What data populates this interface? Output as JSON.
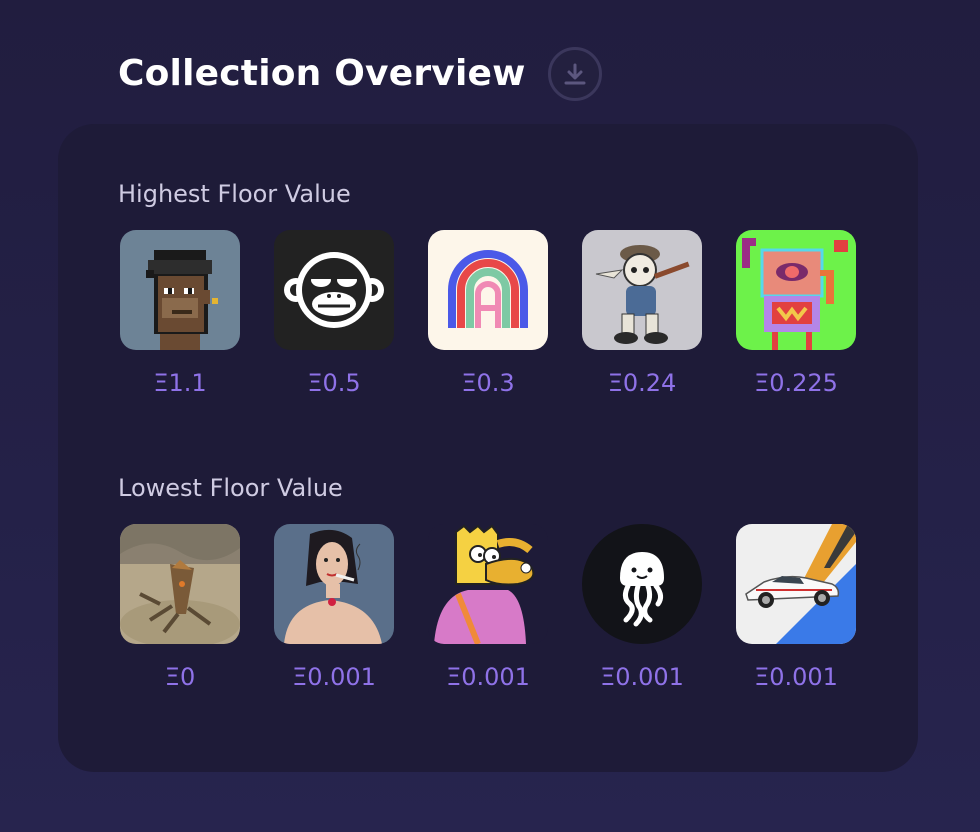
{
  "page": {
    "title": "Collection Overview",
    "download_icon": "download-icon"
  },
  "highest": {
    "title": "Highest Floor Value",
    "items": [
      {
        "price": "Ξ1.1",
        "image": "pixel-ape-avatar"
      },
      {
        "price": "Ξ0.5",
        "image": "monkey-face-logo"
      },
      {
        "price": "Ξ0.3",
        "image": "rainbow-arch-letter-a"
      },
      {
        "price": "Ξ0.24",
        "image": "cartoon-character-walking"
      },
      {
        "price": "Ξ0.225",
        "image": "pixel-robot-green"
      }
    ]
  },
  "lowest": {
    "title": "Lowest Floor Value",
    "items": [
      {
        "price": "Ξ0",
        "image": "desert-creature-render"
      },
      {
        "price": "Ξ0.001",
        "image": "sketched-woman-smoking"
      },
      {
        "price": "Ξ0.001",
        "image": "bart-duck-mashup"
      },
      {
        "price": "Ξ0.001",
        "image": "white-jellyfish-logo"
      },
      {
        "price": "Ξ0.001",
        "image": "white-sports-car"
      }
    ]
  },
  "colors": {
    "background": "#231f44",
    "card": "#1e1b38",
    "price": "#8f72e8",
    "section_title": "#cfcbe2"
  }
}
